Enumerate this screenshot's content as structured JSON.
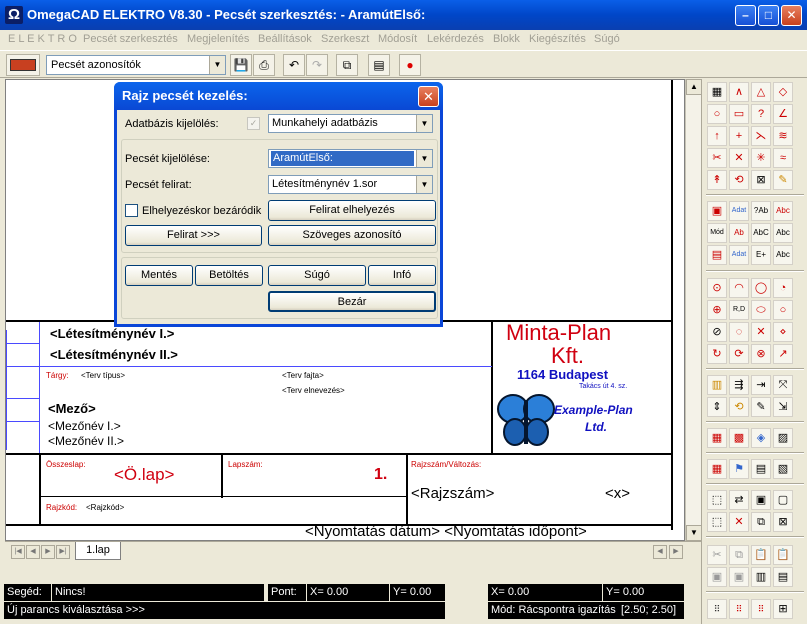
{
  "window": {
    "title": "OmegaCAD ELEKTRO V8.30 - Pecsét szerkesztés: - AramútElső:",
    "app_icon": "omega-icon"
  },
  "menu": [
    "E L E K T R O",
    "Pecsét szerkesztés",
    "Megjelenítés",
    "Beállítások",
    "Szerkeszt",
    "Módosít",
    "Lekérdezés",
    "Blokk",
    "Kiegészítés",
    "Súgó"
  ],
  "toolbar": {
    "layer_select": "Pecsét azonosítók"
  },
  "dialog": {
    "title": "Rajz pecsét kezelés:",
    "db_label": "Adatbázis kijelölés:",
    "db_value": "Munkahelyi adatbázis",
    "stamp_label": "Pecsét kijelölése:",
    "stamp_value": "AramútElső:",
    "caption_label": "Pecsét felirat:",
    "caption_value": "Létesítménynév 1.sor",
    "close_on_place": "Elhelyezéskor bezáródik",
    "place_caption": "Felirat elhelyezés",
    "caption_more": "Felirat >>>",
    "text_id": "Szöveges azonosító",
    "save": "Mentés",
    "load": "Betöltés",
    "help": "Súgó",
    "info": "Infó",
    "close": "Bezár"
  },
  "drawing": {
    "facility1": "<Létesítménynév I.>",
    "facility2": "<Létesítménynév II.>",
    "subject_label": "Tárgy:",
    "plan_type": "<Terv típus>",
    "plan_kind": "<Terv fajta>",
    "plan_name": "<Terv elnevezés>",
    "field": "<Mező>",
    "field1": "<Mezőnév I.>",
    "field2": "<Mezőnév II.>",
    "total_label": "Összeslap:",
    "total_value": "<Ö.lap>",
    "sheet_label": "Lapszám:",
    "sheet_value": "1.",
    "drawing_no_label": "Rajzszám/Változás:",
    "drawing_no": "<Rajzszám>",
    "change": "<x>",
    "code_label": "Rajzkód:",
    "code_value": "<Rajzkód>",
    "company1": "Minta-Plan",
    "company2": "Kft.",
    "address1": "1164 Budapest",
    "address2": "Takács út 4. sz.",
    "logo1": "Example-Plan",
    "logo2": "Ltd.",
    "print_stamp": "<Nyomtatás dátum> <Nyomtatás időpont>"
  },
  "tabs": {
    "sheet": "1.lap"
  },
  "status": {
    "hint_label": "Segéd:",
    "hint_value": "Nincs!",
    "point_label": "Pont:",
    "px": "X= 0.00",
    "py": "Y= 0.00",
    "cx": "X= 0.00",
    "cy": "Y= 0.00",
    "command": "Új parancs kiválasztása >>>",
    "mode": "Mód: Rácspontra igazítás",
    "grid": "[2.50; 2.50]"
  }
}
